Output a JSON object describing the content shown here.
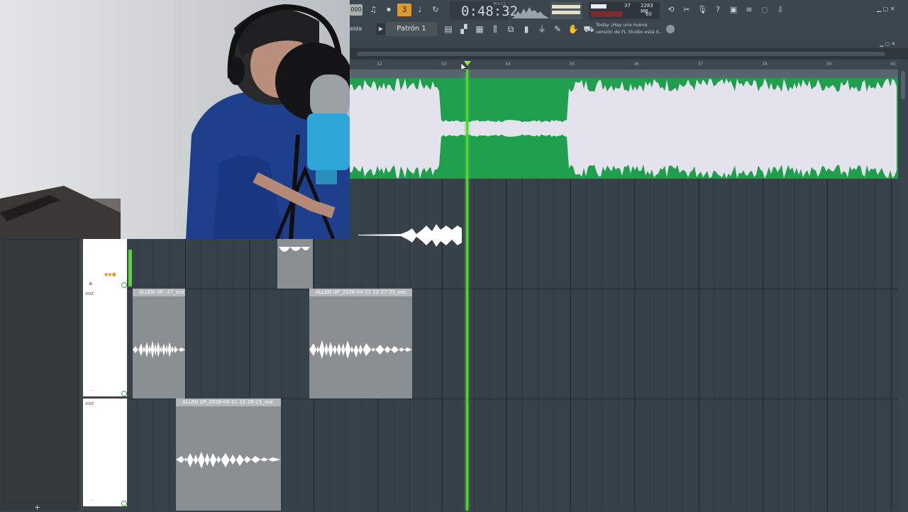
{
  "toolbar": {
    "tempo_label": "000",
    "time": "0:48:32",
    "time_unit": "M:S:CS",
    "cpu": "37",
    "memory": "2283 MB",
    "polyphony": "60",
    "snap_label": "elda",
    "pattern_label": "Patrón 1",
    "news_line1": "Today ¡Hay una nueva",
    "news_line2": "versión de FL Studio está d..",
    "accent": "#e09a2a"
  },
  "playlist": {
    "bar_numbers": [
      "32",
      "33",
      "34",
      "35",
      "36",
      "37",
      "38",
      "39",
      "40"
    ],
    "tracks": [
      {
        "name": "voz"
      },
      {
        "name": "voz"
      }
    ],
    "clips": [
      {
        "title": "ALLEN UP...47_voz"
      },
      {
        "title": "ALLEN UP_2026-04-21 22-27-33_voz"
      },
      {
        "title": "ALLEN UP_2026-04-21 22-26-23_voz"
      }
    ],
    "wave_color": "#1f9e4e",
    "playhead_color": "#55d43a"
  },
  "left_panel": {
    "add_label": "+"
  }
}
